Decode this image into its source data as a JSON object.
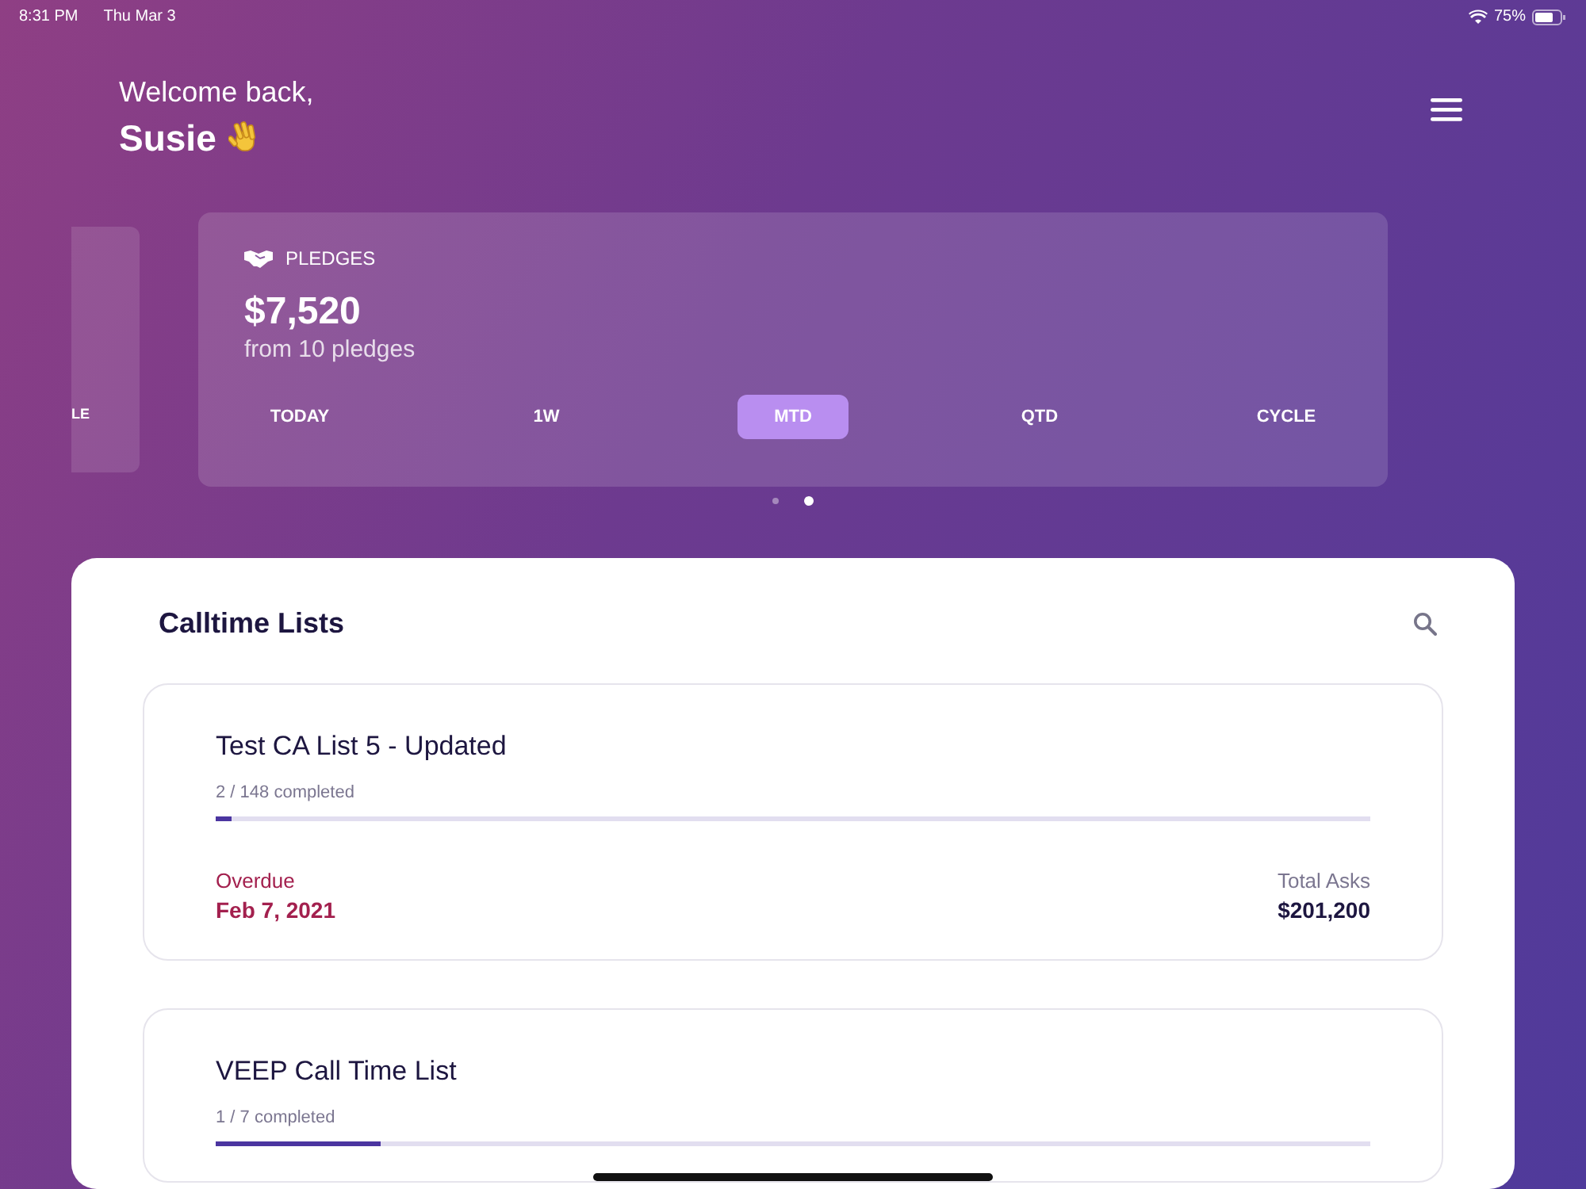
{
  "status_bar": {
    "time": "8:31 PM",
    "date": "Thu Mar 3",
    "battery": "75%"
  },
  "header": {
    "greeting": "Welcome back,",
    "name": "Susie"
  },
  "carousel": {
    "previous_card": {
      "label": "LE"
    },
    "card": {
      "title": "PLEDGES",
      "amount": "$7,520",
      "subtitle": "from 10 pledges",
      "periods": [
        {
          "label": "TODAY",
          "selected": false
        },
        {
          "label": "1W",
          "selected": false
        },
        {
          "label": "MTD",
          "selected": true
        },
        {
          "label": "QTD",
          "selected": false
        },
        {
          "label": "CYCLE",
          "selected": false
        }
      ]
    },
    "pages": [
      {
        "selected": false
      },
      {
        "selected": true
      }
    ]
  },
  "panel": {
    "title": "Calltime Lists",
    "lists": [
      {
        "name": "Test CA List 5 - Updated",
        "progress": "2 / 148 completed",
        "level": 0.014,
        "due_label": "Overdue",
        "due_date": "Feb 7, 2021",
        "total_label": "Total Asks",
        "total": "$201,200"
      },
      {
        "name": "VEEP Call Time List",
        "progress": "1 / 7 completed",
        "level": 0.143
      }
    ]
  }
}
